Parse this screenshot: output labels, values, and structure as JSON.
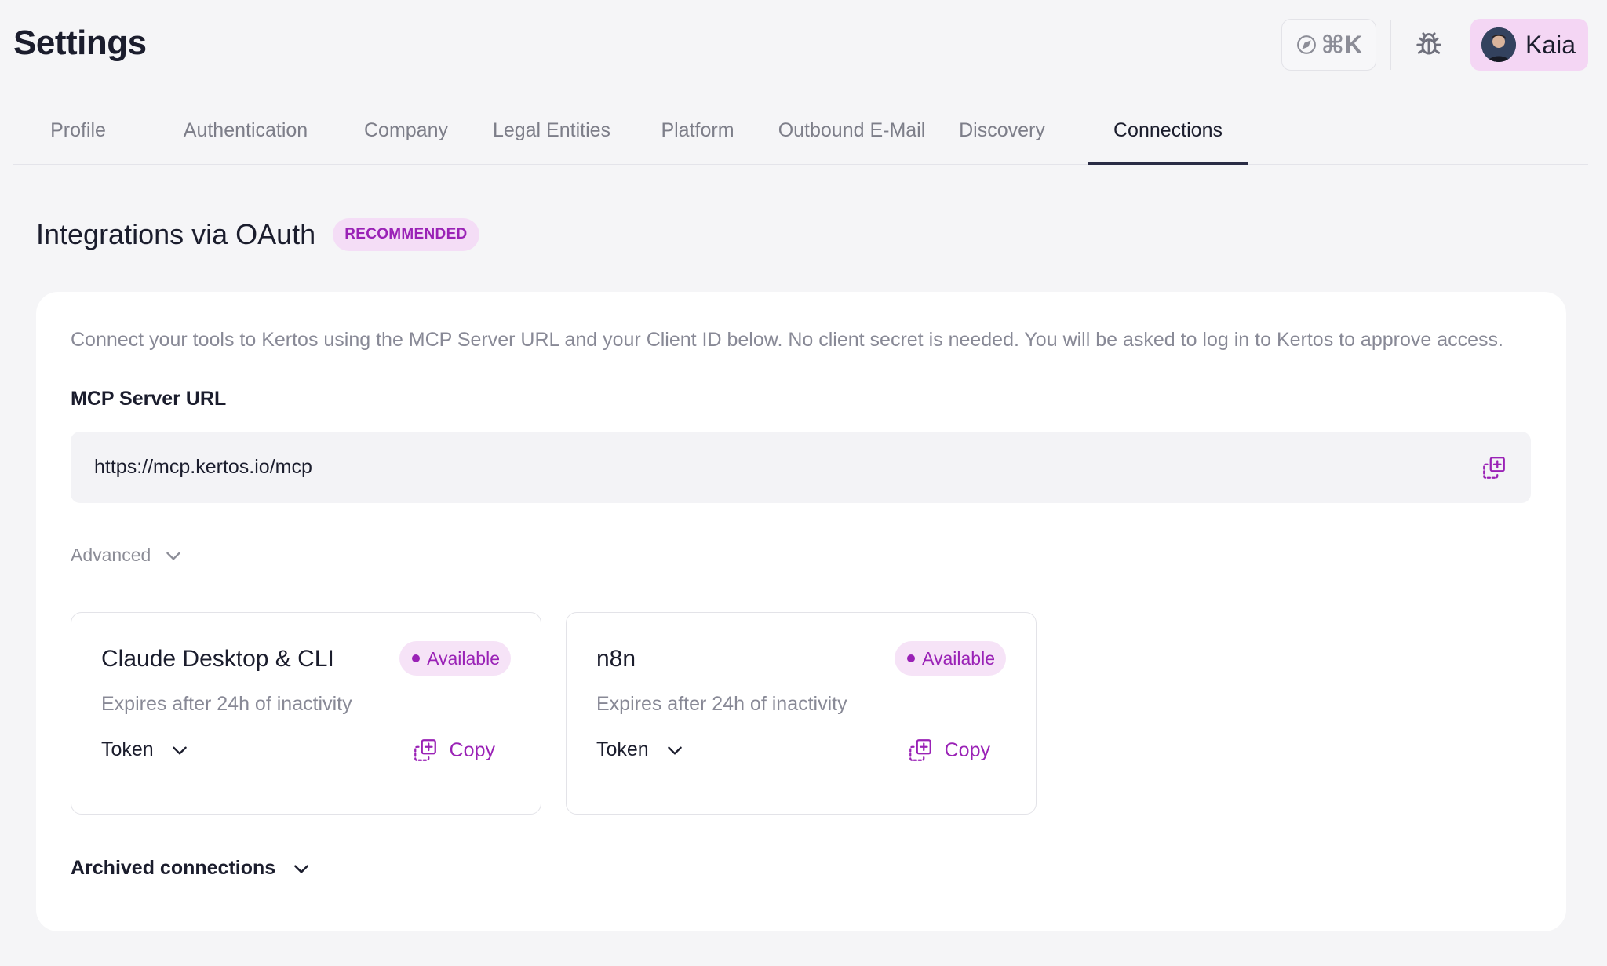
{
  "header": {
    "title": "Settings",
    "command_shortcut": "⌘K",
    "user_name": "Kaia"
  },
  "tabs": [
    {
      "label": "Profile",
      "active": false
    },
    {
      "label": "Authentication",
      "active": false
    },
    {
      "label": "Company",
      "active": false
    },
    {
      "label": "Legal Entities",
      "active": false
    },
    {
      "label": "Platform",
      "active": false
    },
    {
      "label": "Outbound E-Mail",
      "active": false
    },
    {
      "label": "Discovery",
      "active": false
    },
    {
      "label": "Connections",
      "active": true
    }
  ],
  "section": {
    "title": "Integrations via OAuth",
    "badge": "RECOMMENDED",
    "intro": "Connect your tools to Kertos using the MCP Server URL and your Client ID below. No client secret is needed. You will be asked to log in to Kertos to approve access.",
    "url_label": "MCP Server URL",
    "url_value": "https://mcp.kertos.io/mcp",
    "advanced_label": "Advanced",
    "archived_label": "Archived connections"
  },
  "connections": [
    {
      "name": "Claude Desktop & CLI",
      "status": "Available",
      "subtitle": "Expires after 24h of inactivity",
      "token_label": "Token",
      "copy_label": "Copy"
    },
    {
      "name": "n8n",
      "status": "Available",
      "subtitle": "Expires after 24h of inactivity",
      "token_label": "Token",
      "copy_label": "Copy"
    }
  ],
  "colors": {
    "accent": "#9a22b6",
    "badge_bg": "#f4ddf6",
    "user_chip_bg": "#f4d6f4",
    "page_bg": "#f5f5f7",
    "text_primary": "#1b1d2d",
    "text_muted": "#888996"
  },
  "icons": {
    "command": "compass-icon",
    "bug": "bug-icon",
    "copy": "copy-icon",
    "chevron": "chevron-down-icon"
  }
}
